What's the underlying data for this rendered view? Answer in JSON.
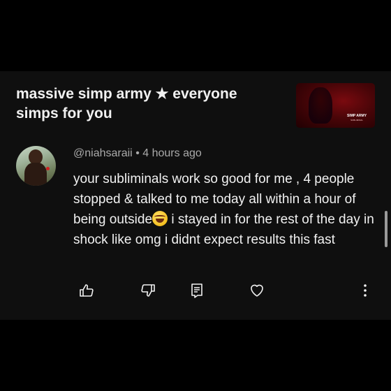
{
  "video": {
    "title": "massive simp army ★ everyone simps for you",
    "thumbnail_text": "SIMP ARMY",
    "thumbnail_subtext": "SUBLIMINAL"
  },
  "comment": {
    "author": "@niahsaraii",
    "separator": "•",
    "time": "4 hours ago",
    "text_before_emoji": "your subliminals work so good for me , 4 people stopped & talked to me today all within a hour of being outside",
    "emoji": "face-with-tears-of-joy",
    "text_after_emoji": " i stayed in for the rest of the day in shock like omg i didnt expect results this fast"
  },
  "actions": {
    "like": "thumbs-up-icon",
    "dislike": "thumbs-down-icon",
    "reply": "reply-icon",
    "heart": "heart-icon",
    "more": "more-vertical-icon"
  },
  "colors": {
    "background": "#000000",
    "panel": "#0f0f0f",
    "text_primary": "#f1f1f1",
    "text_secondary": "#aaaaaa",
    "thumbnail_red": "#7a0a0f"
  }
}
